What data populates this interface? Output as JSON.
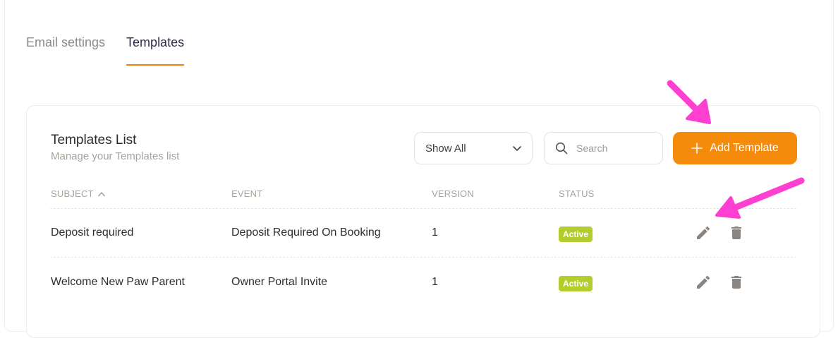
{
  "tabs": [
    {
      "label": "Email settings",
      "active": false
    },
    {
      "label": "Templates",
      "active": true
    }
  ],
  "card": {
    "title": "Templates List",
    "subtitle": "Manage your Templates list"
  },
  "filter": {
    "selected": "Show All"
  },
  "search": {
    "placeholder": "Search"
  },
  "add_button": {
    "label": "Add Template"
  },
  "table": {
    "headers": {
      "subject": "SUBJECT",
      "event": "EVENT",
      "version": "VERSION",
      "status": "STATUS"
    },
    "sort_indicator": "^",
    "rows": [
      {
        "subject": "Deposit required",
        "event": "Deposit Required On Booking",
        "version": "1",
        "status": "Active"
      },
      {
        "subject": "Welcome New Paw Parent",
        "event": "Owner Portal Invite",
        "version": "1",
        "status": "Active"
      }
    ]
  },
  "colors": {
    "accent": "#f58b0b",
    "active_badge": "#b3cd2e",
    "annotation_arrow": "#ff3fd1"
  },
  "icons": [
    "chevron-down-icon",
    "search-icon",
    "plus-icon",
    "pencil-icon",
    "trash-icon",
    "annotation-arrow"
  ]
}
